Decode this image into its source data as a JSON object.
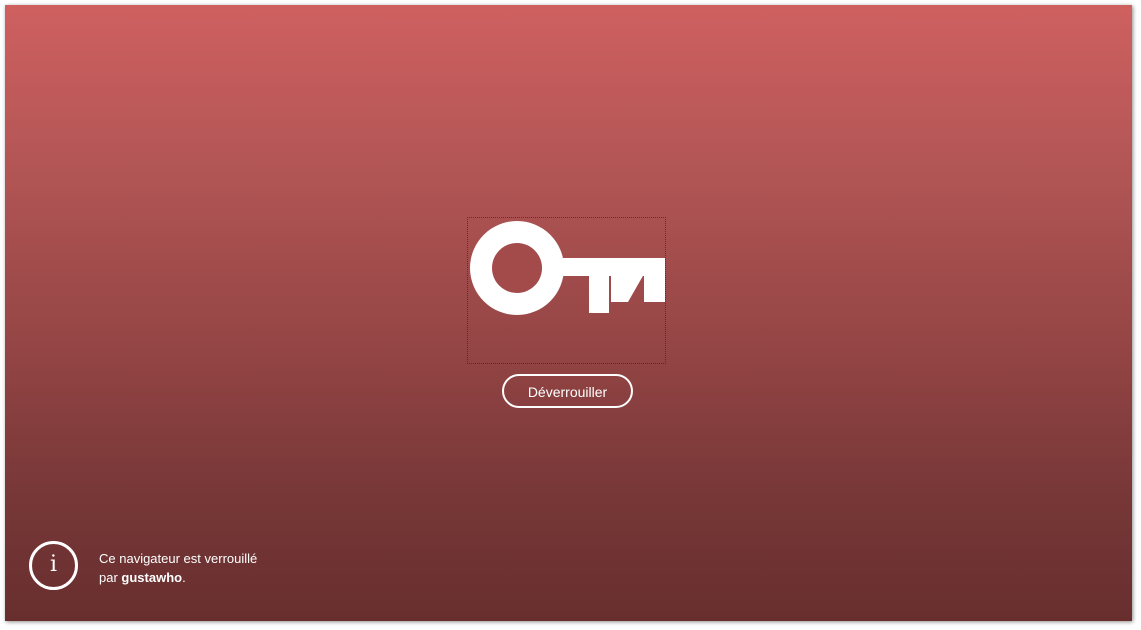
{
  "lock_screen": {
    "key_icon": "key-icon",
    "unlock_button_label": "Déverrouiller",
    "info_icon": "info-icon",
    "info_glyph": "i",
    "message_line1": "Ce navigateur est verrouillé",
    "message_line2_prefix": "par ",
    "message_user": "gustawho",
    "message_line2_suffix": "."
  },
  "colors": {
    "gradient_top": "#cf6060",
    "gradient_bottom": "#682e2e",
    "foreground": "#ffffff"
  }
}
